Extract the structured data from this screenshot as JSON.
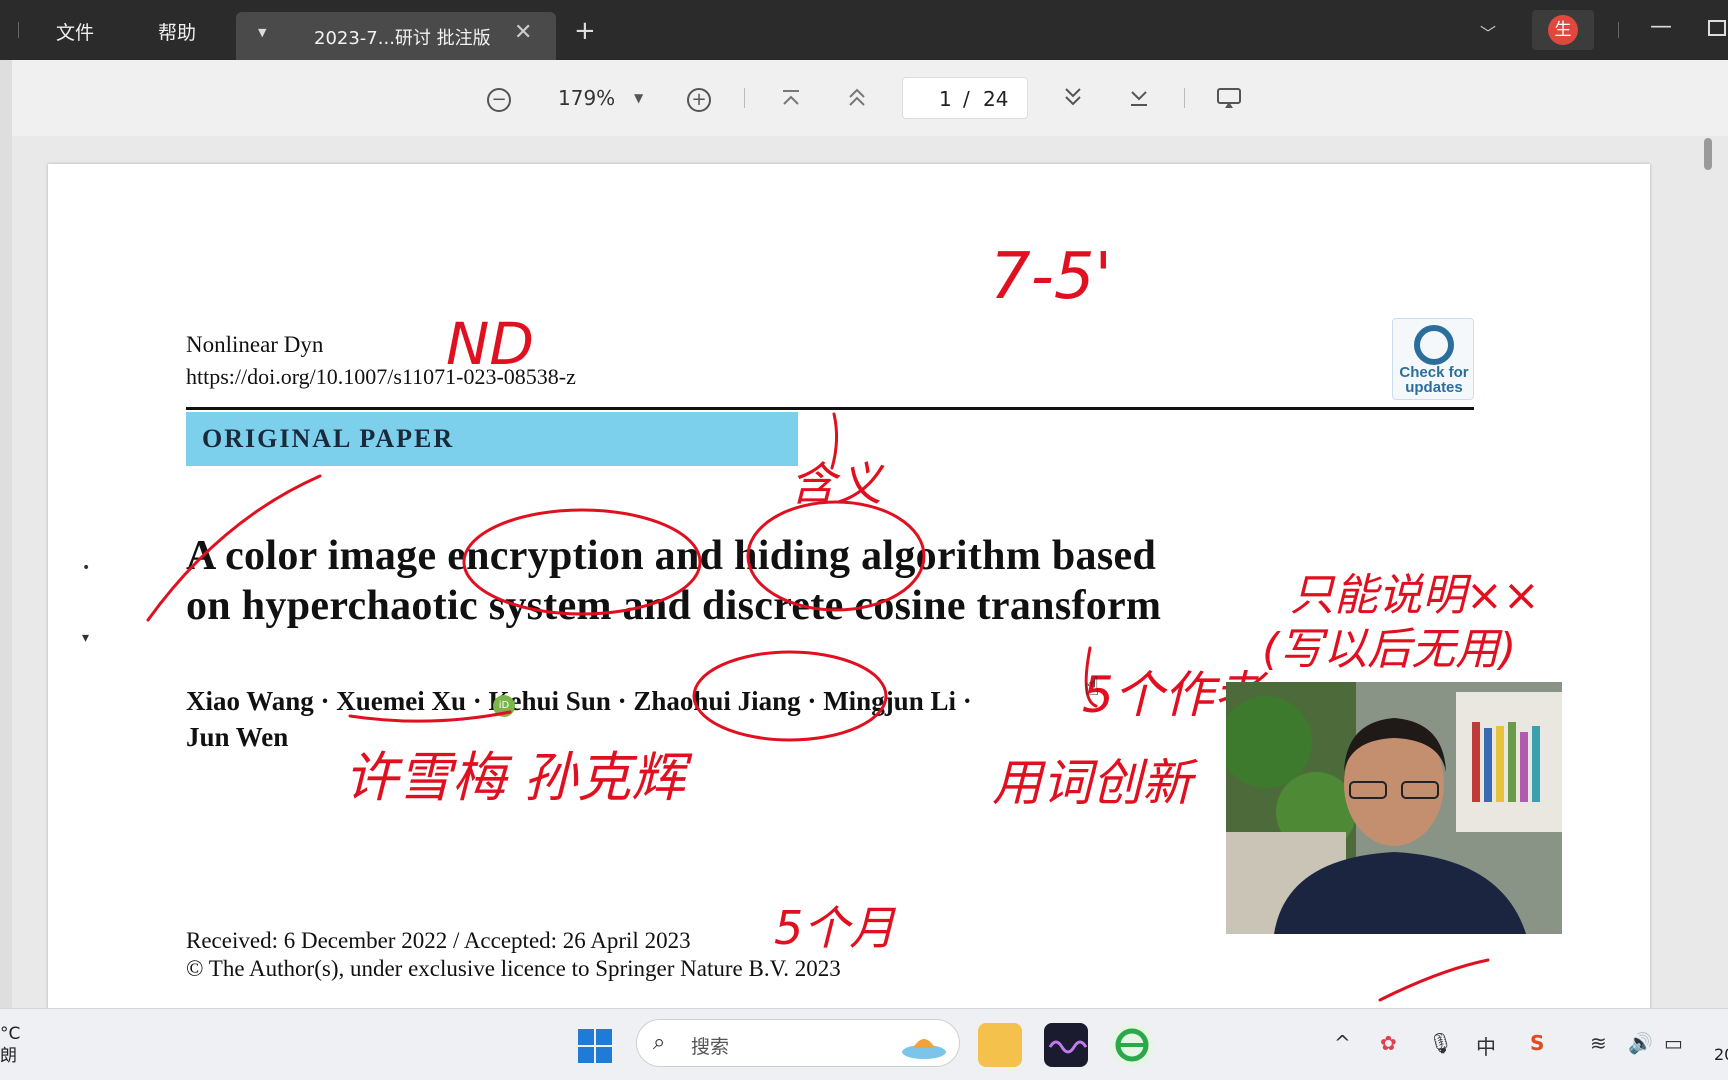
{
  "titlebar": {
    "menu": [
      "文件",
      "帮助"
    ],
    "tab_title": "2023-7...研讨 批注版",
    "tab_close": "✕",
    "new_tab": "+",
    "avatar_text": "生"
  },
  "toolbar": {
    "zoom": "179%",
    "current_page": "1",
    "separator": "/",
    "total_pages": "24"
  },
  "paper": {
    "journal": "Nonlinear Dyn",
    "doi": "https://doi.org/10.1007/s11071-023-08538-z",
    "section_label": "ORIGINAL PAPER",
    "check_updates": [
      "Check for",
      "updates"
    ],
    "title_line1": "A color image encryption and hiding algorithm based",
    "title_line2": "on hyperchaotic system and discrete cosine transform",
    "authors_line1": "Xiao Wang · Xuemei Xu  · Kehui Sun · Zhaohui Jiang · Mingjun Li ·",
    "authors_line2": "Jun Wen",
    "received": "Received: 6 December 2022 / Accepted: 26 April 2023",
    "copyright": "© The Author(s), under exclusive licence to Springer Nature B.V. 2023"
  },
  "annotations": {
    "top": "7-5'",
    "nd": "ND",
    "meaning": "含义",
    "names": "许雪梅 孙克辉",
    "right1": "只能说明××",
    "right2": "(写以后无用)",
    "right3": "5个作者",
    "right4": "用词创新",
    "bottom": "5个月"
  },
  "taskbar": {
    "weather_temp": "°C",
    "weather_text": "朗",
    "search_placeholder": "搜索",
    "clock_fragment": "20"
  },
  "colors": {
    "annotation_red": "#e01020",
    "section_band": "#7dd0ec",
    "titlebar": "#2b2b2b"
  }
}
